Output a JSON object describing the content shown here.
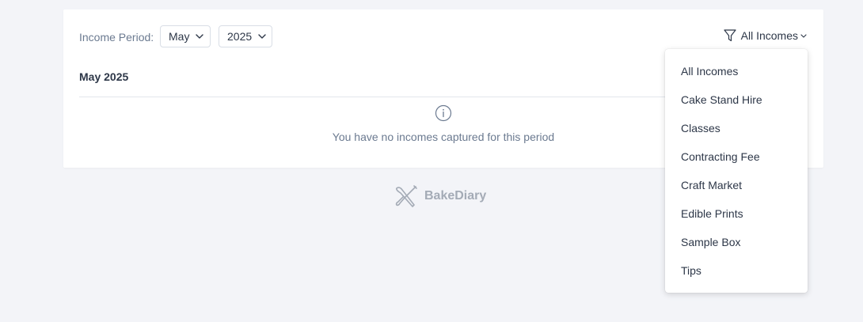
{
  "filters": {
    "period_label": "Income Period:",
    "month": "May",
    "year": "2025",
    "category_filter": "All Incomes"
  },
  "period": {
    "title": "May 2025",
    "empty_message": "You have no incomes captured for this period"
  },
  "brand": {
    "name": "BakeDiary"
  },
  "dropdown": {
    "items": [
      "All Incomes",
      "Cake Stand Hire",
      "Classes",
      "Contracting Fee",
      "Craft Market",
      "Edible Prints",
      "Sample Box",
      "Tips"
    ]
  },
  "colors": {
    "background": "#f3f4f8",
    "card": "#ffffff",
    "text": "#2d3748",
    "muted": "#6b7a90",
    "brand_muted": "#a4abb6"
  },
  "icons": {
    "filter": "funnel-icon",
    "chevron": "chevron-down-icon",
    "info": "info-circle-icon",
    "logo": "crossed-baking-tools-icon"
  }
}
